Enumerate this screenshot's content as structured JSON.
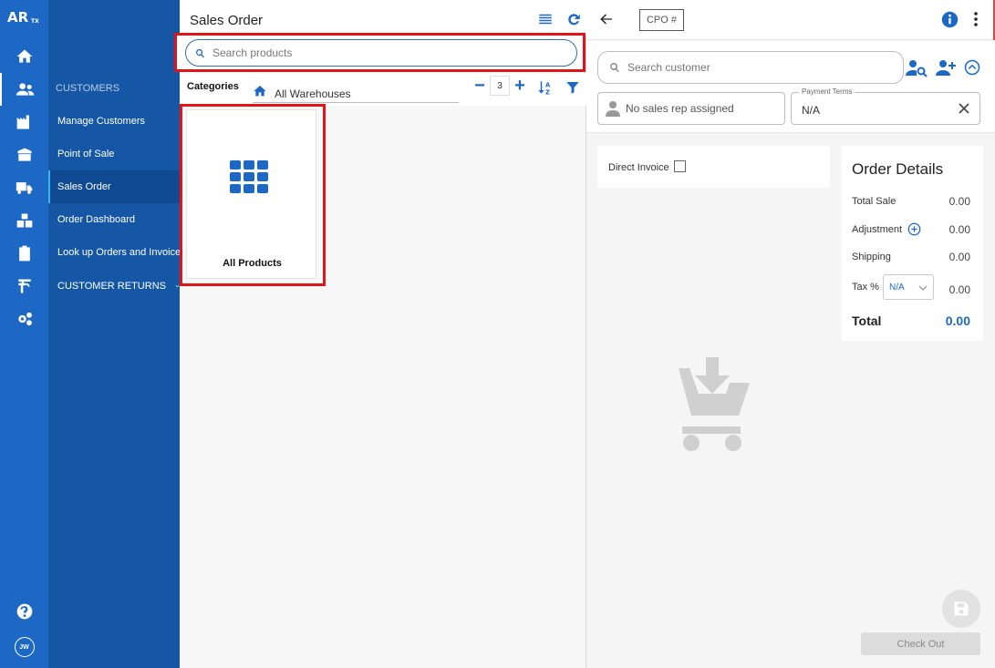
{
  "rail": {
    "logo_text": "AR",
    "logo_sub": "TX",
    "avatar_initials": "JW"
  },
  "nav": {
    "section": "CUSTOMERS",
    "items": [
      {
        "label": "Manage Customers"
      },
      {
        "label": "Point of Sale"
      },
      {
        "label": "Sales Order",
        "active": true
      },
      {
        "label": "Order Dashboard"
      },
      {
        "label": "Look up Orders and Invoices"
      },
      {
        "label": "CUSTOMER RETURNS"
      }
    ]
  },
  "products": {
    "title": "Sales Order",
    "search_placeholder": "Search products",
    "categories_label": "Categories",
    "warehouse": "All Warehouses",
    "columns_value": "3",
    "card_label": "All Products"
  },
  "order": {
    "cpo_placeholder": "CPO #",
    "customer_search_placeholder": "Search customer",
    "sales_rep": "No sales rep assigned",
    "payment_terms_label": "Payment Terms",
    "payment_terms_value": "N/A",
    "direct_invoice_label": "Direct Invoice",
    "details_title": "Order Details",
    "total_sale_label": "Total Sale",
    "total_sale": "0.00",
    "adjustment_label": "Adjustment",
    "adjustment": "0.00",
    "shipping_label": "Shipping",
    "shipping": "0.00",
    "tax_label": "Tax %",
    "tax_select": "N/A",
    "tax": "0.00",
    "total_label": "Total",
    "total": "0.00",
    "checkout_label": "Check Out"
  },
  "colors": {
    "rail": "#1c68c4",
    "nav": "#1557a5",
    "accent": "#1c68c4",
    "highlight": "#e0141b"
  }
}
